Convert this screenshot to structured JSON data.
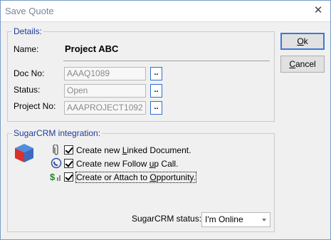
{
  "window": {
    "title": "Save Quote"
  },
  "details": {
    "group_title": "Details:",
    "name_label": "Name:",
    "name_value": "Project ABC",
    "doc_no_label": "Doc No:",
    "doc_no_value": "AAAQ1089",
    "status_label": "Status:",
    "status_value": "Open",
    "project_no_label": "Project No:",
    "project_no_value": "AAAPROJECT1092",
    "browse_label": ".."
  },
  "sugar": {
    "group_title": "SugarCRM integration:",
    "options": [
      {
        "pre": "Create new ",
        "key": "L",
        "post": "inked Document.",
        "checked": true
      },
      {
        "pre": "Create new Follow ",
        "key": "u",
        "post": "p Call.",
        "checked": true
      },
      {
        "pre": "Create or Attach to ",
        "key": "O",
        "post": "pportunity.",
        "checked": true
      }
    ],
    "status_label": "SugarCRM status:",
    "status_value": "I'm Online"
  },
  "buttons": {
    "ok_pre": "",
    "ok_key": "O",
    "ok_post": "k",
    "cancel_pre": "",
    "cancel_key": "C",
    "cancel_post": "ancel"
  },
  "colors": {
    "group_title": "#1b3d99",
    "accent": "#3a7ad9"
  }
}
